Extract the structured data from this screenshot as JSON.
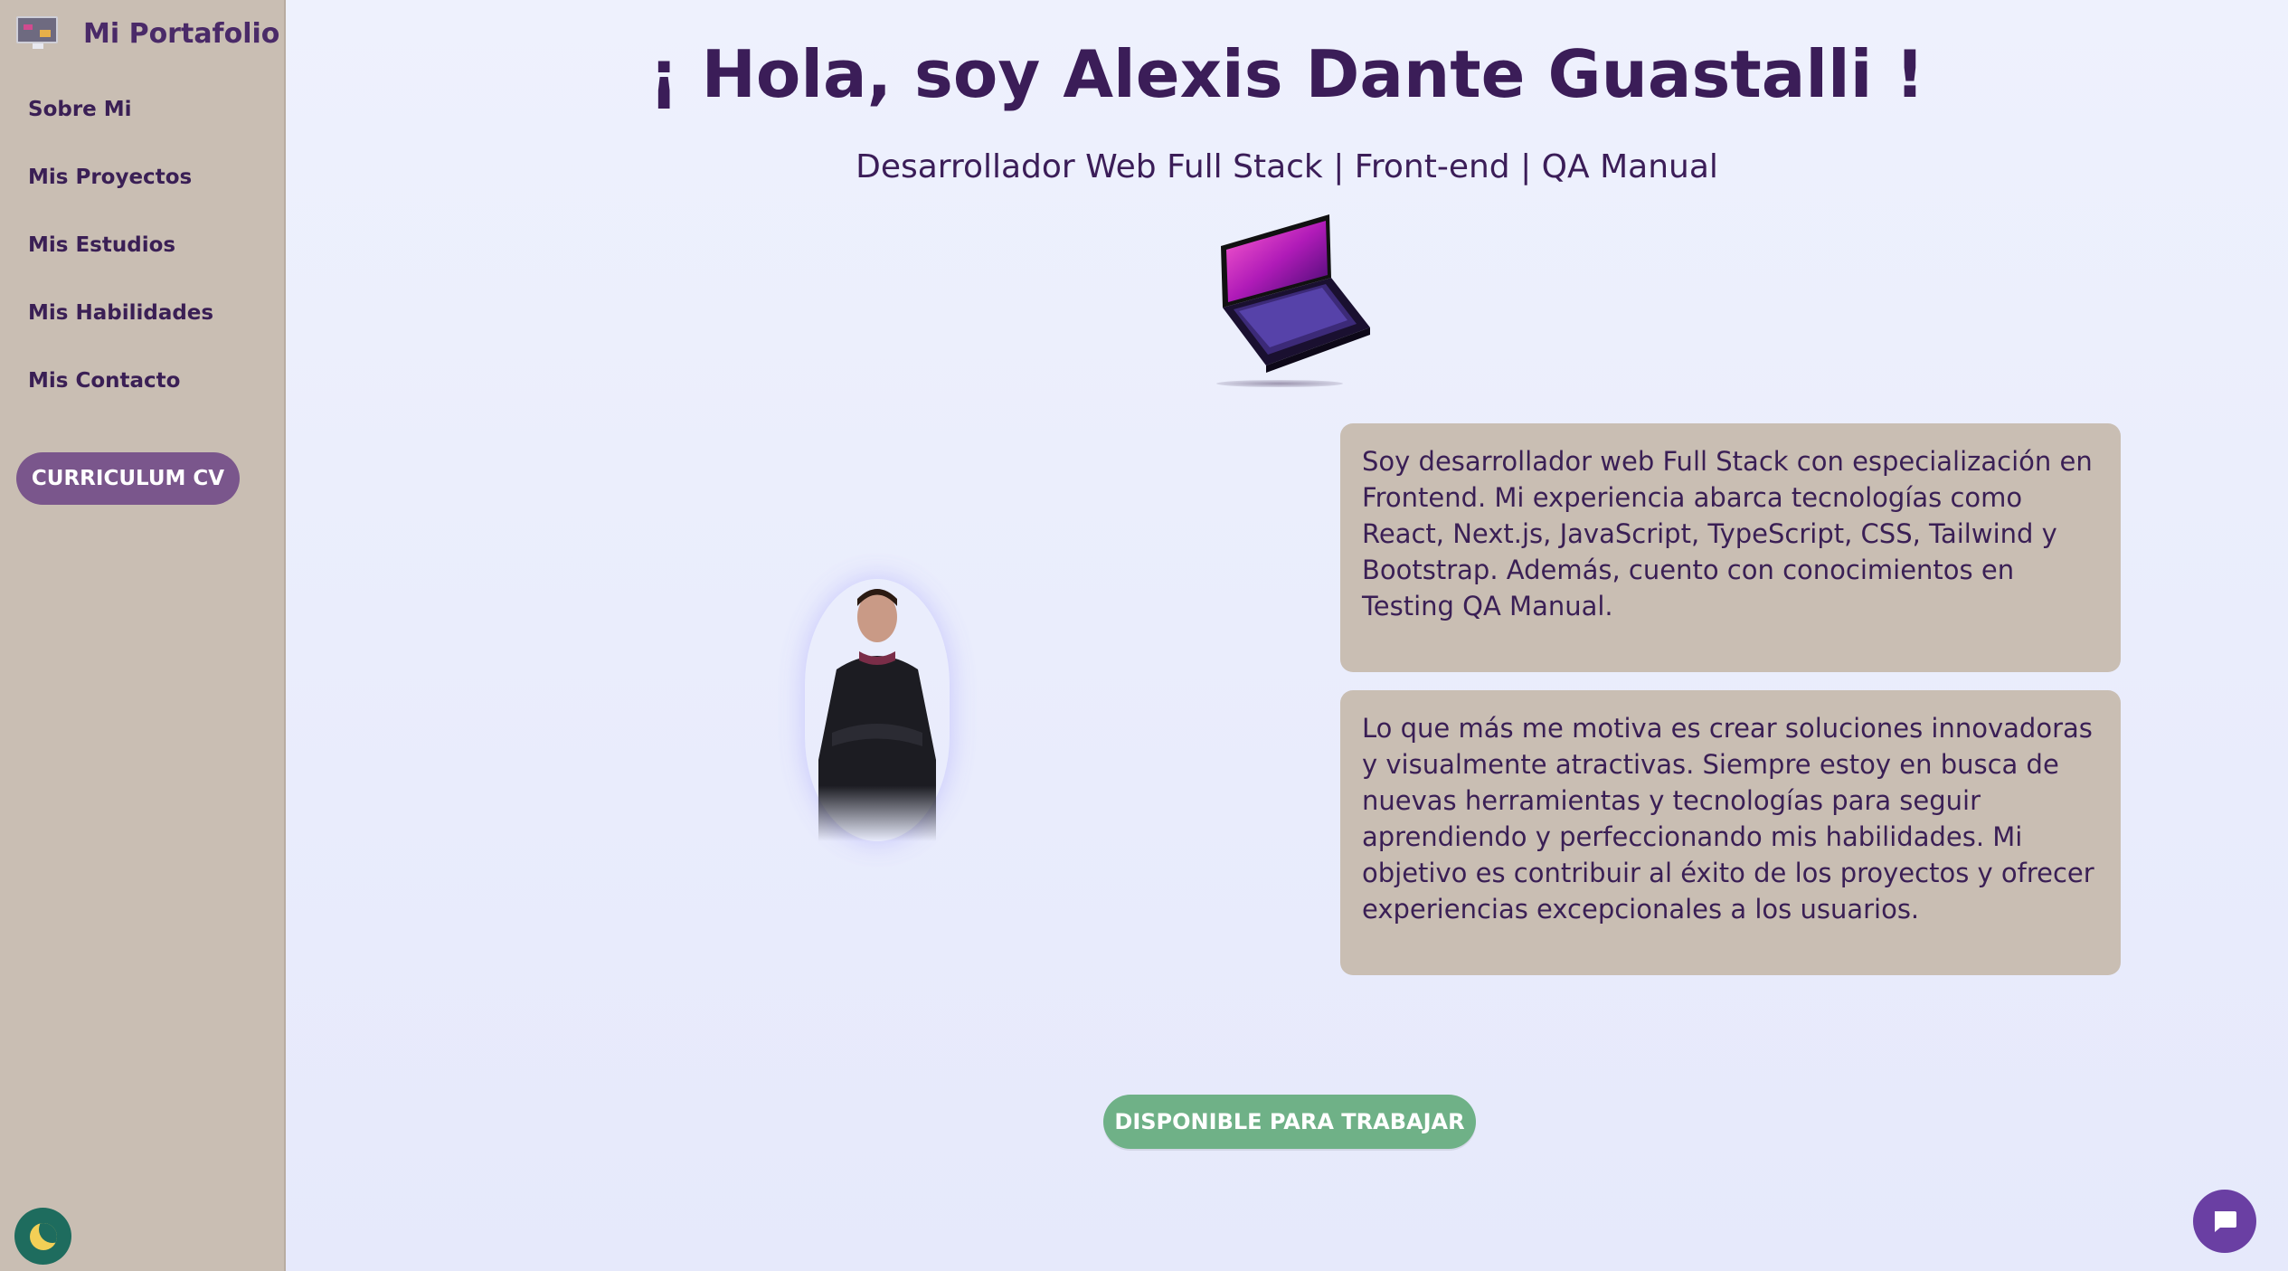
{
  "sidebar": {
    "brand_title": "Mi Portafolio",
    "items": [
      {
        "label": "Sobre Mi"
      },
      {
        "label": "Mis Proyectos"
      },
      {
        "label": "Mis Estudios"
      },
      {
        "label": "Mis Habilidades"
      },
      {
        "label": "Mis Contacto"
      }
    ],
    "cv_button": "CURRICULUM CV",
    "theme_icon": "moon-icon"
  },
  "main": {
    "headline": "¡ Hola, soy Alexis Dante Guastalli !",
    "subtitle": "Desarrollador Web Full Stack | Front-end | QA Manual",
    "about_1": "Soy desarrollador web Full Stack con especialización en Frontend. Mi experiencia abarca tecnologías como React, Next.js, JavaScript, TypeScript, CSS, Tailwind y Bootstrap. Además, cuento con conocimientos en Testing QA Manual.",
    "about_2": "Lo que más me motiva es crear soluciones innovadoras y visualmente atractivas. Siempre estoy en busca de nuevas herramientas y tecnologías para seguir aprendiendo y perfeccionando mis habilidades. Mi objetivo es contribuir al éxito de los proyectos y ofrecer experiencias excepcionales a los usuarios.",
    "available_button": "DISPONIBLE PARA TRABAJAR",
    "chat_icon": "chat-bubble-icon"
  },
  "colors": {
    "sidebar_bg": "#c9beb3",
    "accent_purple": "#7a568c",
    "text_dark": "#3b1d58",
    "available_green": "#6fb187",
    "chat_purple": "#6a3fa3"
  }
}
